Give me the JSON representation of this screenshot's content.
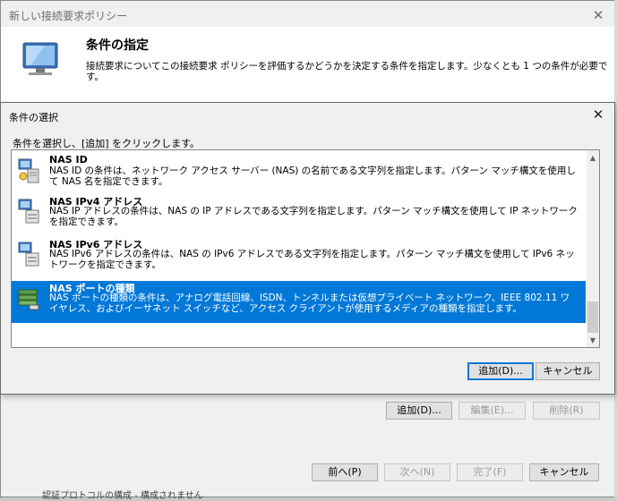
{
  "wizard": {
    "title": "新しい接続要求ポリシー",
    "header_title": "条件の指定",
    "header_desc": "接続要求についてこの接続要求 ポリシーを評価するかどうかを決定する条件を指定します。少なくとも 1 つの条件が必要です。",
    "add_button": "追加(D)...",
    "edit_button": "編集(E)...",
    "remove_button": "削除(R)",
    "prev_button": "前へ(P)",
    "next_button": "次へ(N)",
    "finish_button": "完了(F)",
    "cancel_button": "キャンセル",
    "bottom_text": "認証プロトコルの構成 - 構成されません"
  },
  "dialog": {
    "title": "条件の選択",
    "prompt": "条件を選択し、[追加] をクリックします。",
    "items": [
      {
        "name": "NAS ID",
        "desc": "NAS ID の条件は、ネットワーク アクセス サーバー (NAS) の名前である文字列を指定します。パターン マッチ構文を使用して NAS 名を指定できます。"
      },
      {
        "name": "NAS IPv4 アドレス",
        "desc": "NAS IP アドレスの条件は、NAS の IP アドレスである文字列を指定します。パターン マッチ構文を使用して IP ネットワークを指定できます。"
      },
      {
        "name": "NAS IPv6 アドレス",
        "desc": "NAS IPv6 アドレスの条件は、NAS の IPv6 アドレスである文字列を指定します。パターン マッチ構文を使用して IPv6 ネットワークを指定できます。"
      },
      {
        "name": "NAS ポートの種類",
        "desc": "NAS ポートの種類の条件は、アナログ電話回線、ISDN、トンネルまたは仮想プライベート ネットワーク、IEEE 802.11 ワイヤレス、およびイーサネット スイッチなど、アクセス クライアントが使用するメディアの種類を指定します。"
      }
    ],
    "add_button": "追加(D)...",
    "cancel_button": "キャンセル"
  },
  "icons": {
    "close": "close-icon",
    "monitor": "monitor-icon",
    "server": "server-icon",
    "network_device": "network-device-icon"
  },
  "colors": {
    "selection": "#0078d7",
    "window_bg": "#f0f0f0"
  }
}
